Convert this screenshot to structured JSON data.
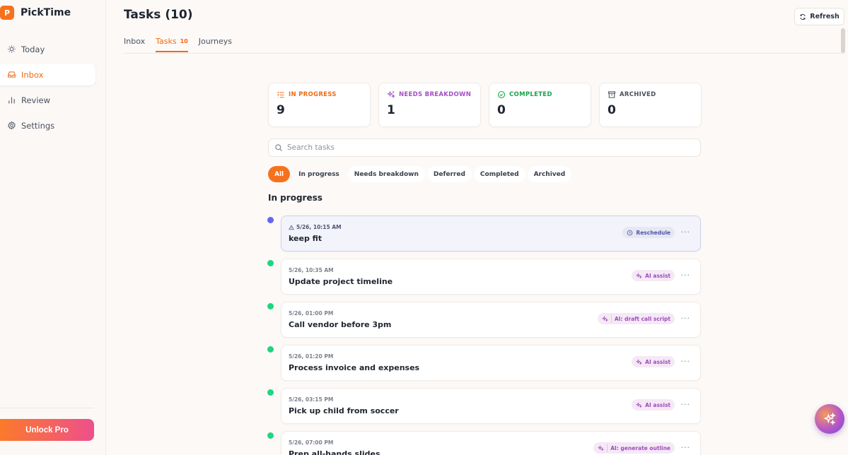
{
  "app": {
    "logo_letter": "P",
    "name": "PickTime"
  },
  "sidebar": {
    "items": [
      {
        "label": "Today",
        "icon": "sun-icon",
        "active": false
      },
      {
        "label": "Inbox",
        "icon": "inbox-icon",
        "active": true
      },
      {
        "label": "Review",
        "icon": "bar-chart-icon",
        "active": false
      },
      {
        "label": "Settings",
        "icon": "gear-icon",
        "active": false
      }
    ],
    "unlock_label": "Unlock Pro"
  },
  "header": {
    "title": "Tasks (10)",
    "refresh_label": "Refresh",
    "tabs": [
      {
        "label": "Inbox",
        "count": ""
      },
      {
        "label": "Tasks",
        "count": "10"
      },
      {
        "label": "Journeys",
        "count": ""
      }
    ]
  },
  "stats": [
    {
      "label": "IN PROGRESS",
      "value": "9",
      "color": "#f06a14",
      "icon": "list-icon"
    },
    {
      "label": "NEEDS BREAKDOWN",
      "value": "1",
      "color": "#a44fc4",
      "icon": "sparkles-icon"
    },
    {
      "label": "COMPLETED",
      "value": "0",
      "color": "#19a34a",
      "icon": "check-circle-icon"
    },
    {
      "label": "ARCHIVED",
      "value": "0",
      "color": "#4a5160",
      "icon": "archive-icon"
    }
  ],
  "search": {
    "placeholder": "Search tasks"
  },
  "filters": [
    "All",
    "In progress",
    "Needs breakdown",
    "Deferred",
    "Completed",
    "Archived"
  ],
  "section_title": "In progress",
  "tasks": [
    {
      "time": "5/26, 10:15 AM",
      "title": "keep fit",
      "action": "Reschedule",
      "action_type": "reschedule",
      "dot_color": "#6366f1",
      "overdue": true
    },
    {
      "time": "5/26, 10:35 AM",
      "title": "Update project timeline",
      "action": "AI assist",
      "action_type": "ai",
      "dot_color": "#1fd67d",
      "overdue": false
    },
    {
      "time": "5/26, 01:00 PM",
      "title": "Call vendor before 3pm",
      "action": "AI: draft call script",
      "action_type": "ai-wide",
      "dot_color": "#1fd67d",
      "overdue": false
    },
    {
      "time": "5/26, 01:20 PM",
      "title": "Process invoice and expenses",
      "action": "AI assist",
      "action_type": "ai",
      "dot_color": "#1fd67d",
      "overdue": false
    },
    {
      "time": "5/26, 03:15 PM",
      "title": "Pick up child from soccer",
      "action": "AI assist",
      "action_type": "ai",
      "dot_color": "#1fd67d",
      "overdue": false
    },
    {
      "time": "5/26, 07:00 PM",
      "title": "Prep all-hands slides",
      "action": "AI: generate outline",
      "action_type": "ai-wide",
      "dot_color": "#1fd67d",
      "overdue": false
    }
  ],
  "more_label": "···"
}
